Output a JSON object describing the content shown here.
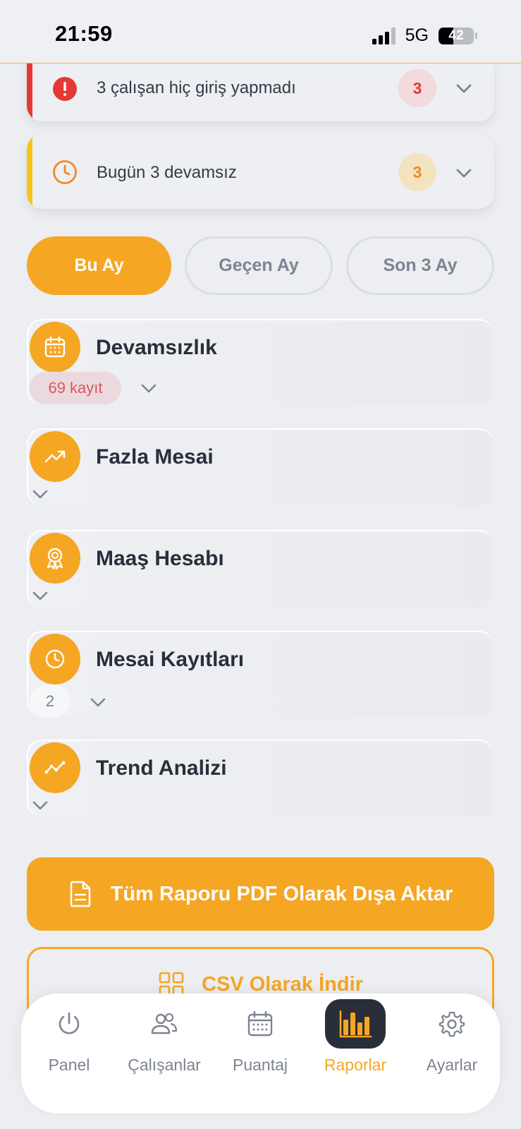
{
  "status_bar": {
    "time": "21:59",
    "network": "5G",
    "battery": "42"
  },
  "alerts": [
    {
      "text": "3 çalışan hiç giriş yapmadı",
      "count": "3",
      "icon": "alert-circle-icon",
      "color": "#e53935"
    },
    {
      "text": "Bugün 3 devamsız",
      "count": "3",
      "icon": "clock-icon",
      "color": "#f5a623"
    }
  ],
  "period_filter": {
    "options": [
      "Bu Ay",
      "Geçen Ay",
      "Son 3 Ay"
    ],
    "selected": "Bu Ay"
  },
  "sections": [
    {
      "title": "Devamsızlık",
      "icon": "calendar-icon",
      "count": "69 kayıt"
    },
    {
      "title": "Fazla Mesai",
      "icon": "trending-up-icon"
    },
    {
      "title": "Maaş Hesabı",
      "icon": "award-icon"
    },
    {
      "title": "Mesai Kayıtları",
      "icon": "clock-icon",
      "count": "2"
    },
    {
      "title": "Trend Analizi",
      "icon": "trend-line-icon"
    }
  ],
  "actions": {
    "pdf_label": "Tüm Raporu PDF Olarak Dışa Aktar",
    "csv_label": "CSV Olarak İndir"
  },
  "tabs": [
    {
      "label": "Panel",
      "icon": "power-icon"
    },
    {
      "label": "Çalışanlar",
      "icon": "users-icon"
    },
    {
      "label": "Puantaj",
      "icon": "calendar-icon"
    },
    {
      "label": "Raporlar",
      "icon": "bar-chart-icon",
      "active": true
    },
    {
      "label": "Ayarlar",
      "icon": "gear-icon"
    }
  ],
  "colors": {
    "accent": "#f5a623",
    "danger": "#e53935",
    "dark": "#2a2e3a",
    "muted": "#7d8391"
  }
}
